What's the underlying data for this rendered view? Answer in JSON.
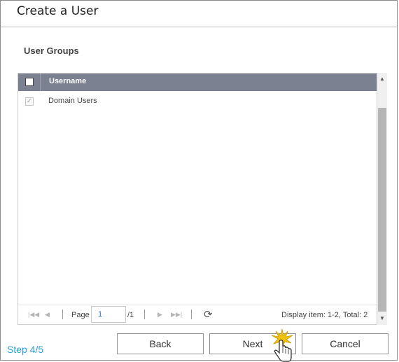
{
  "dialog": {
    "title": "Create a User",
    "section_label": "User Groups"
  },
  "grid": {
    "column_header": "Username",
    "rows": [
      {
        "name": "Domain Users",
        "checked": true,
        "disabled": true
      }
    ]
  },
  "pager": {
    "page_label": "Page",
    "page_value": "1",
    "page_total": "/1",
    "display_text": "Display item: 1-2, Total: 2",
    "icons": [
      "first-page-icon",
      "prev-page-icon",
      "next-page-icon",
      "last-page-icon",
      "refresh-icon"
    ]
  },
  "footer": {
    "step": "Step 4/5",
    "back_label": "Back",
    "next_label": "Next",
    "cancel_label": "Cancel"
  },
  "colors": {
    "header_bg": "#7b8191",
    "step_text": "#2b9fd4",
    "cursor_burst": "#f2c20f"
  }
}
